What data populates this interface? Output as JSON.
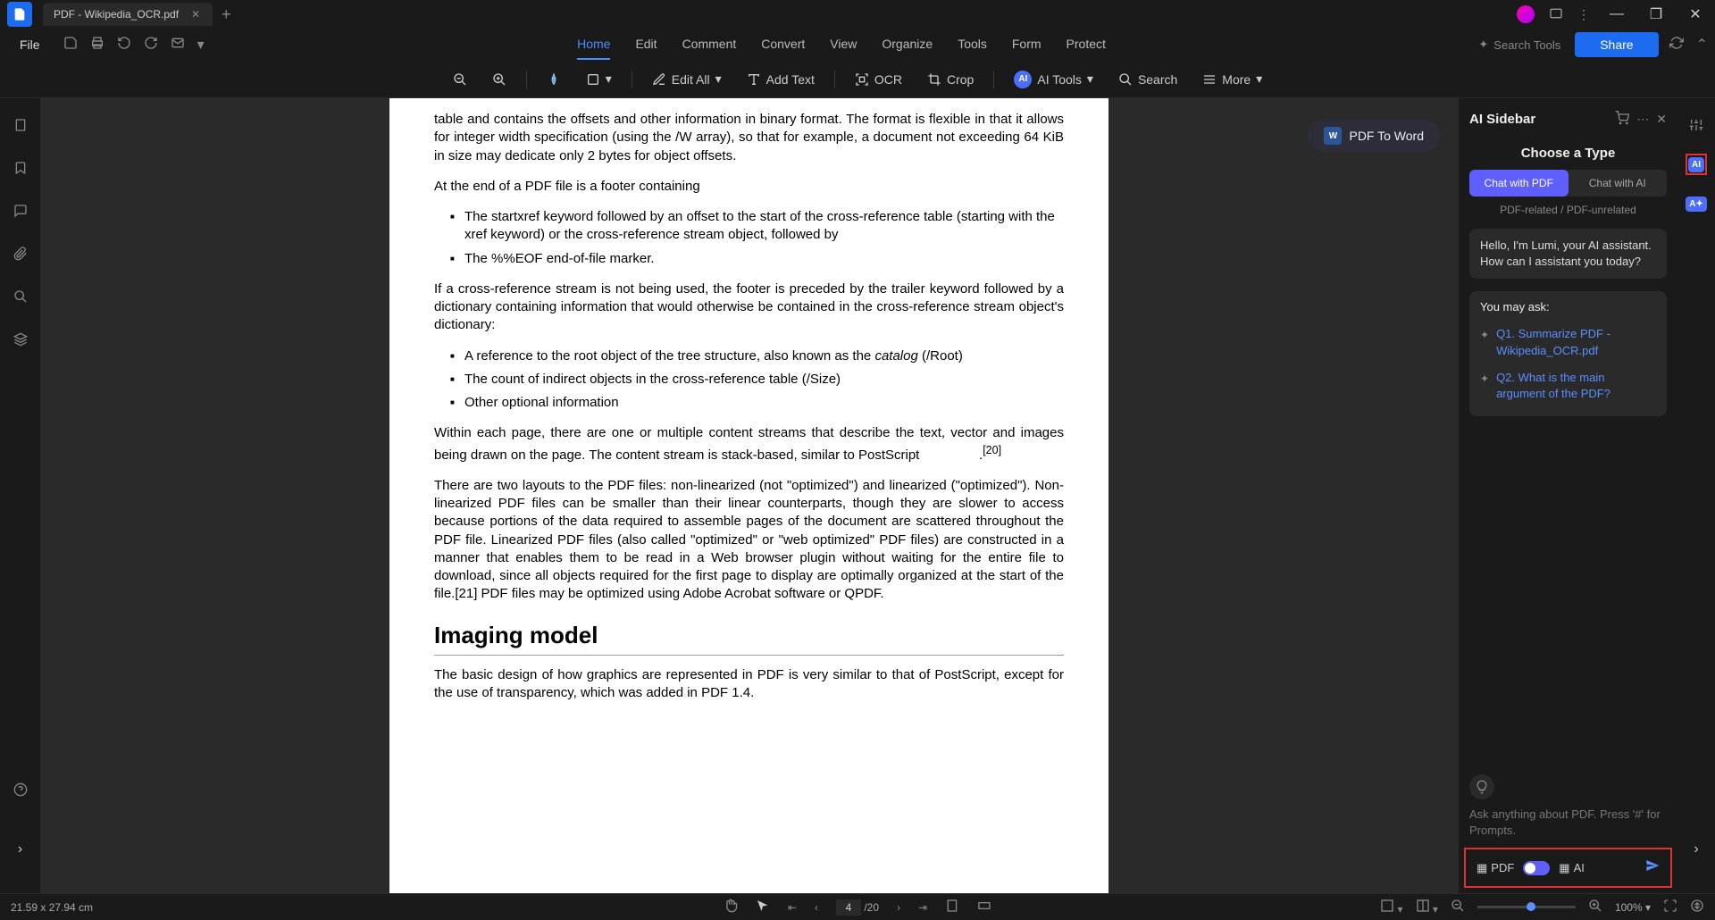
{
  "titlebar": {
    "tab_name": "PDF - Wikipedia_OCR.pdf"
  },
  "menubar": {
    "file": "File",
    "tabs": [
      "Home",
      "Edit",
      "Comment",
      "Convert",
      "View",
      "Organize",
      "Tools",
      "Form",
      "Protect"
    ],
    "active_tab": "Home",
    "search_tools": "Search Tools",
    "share": "Share"
  },
  "toolbar": {
    "edit_all": "Edit All",
    "add_text": "Add Text",
    "ocr": "OCR",
    "crop": "Crop",
    "ai_tools": "AI Tools",
    "search": "Search",
    "more": "More"
  },
  "pdf_to_word": "PDF To Word",
  "document": {
    "p1": "table and contains the offsets and other information in binary format. The format is flexible in that it allows for integer width specification (using the /W array), so that for example, a document not exceeding 64 KiB in size may dedicate only 2 bytes for object offsets.",
    "p2": "At the end of a PDF file is a footer containing",
    "li1": "The startxref keyword followed by an offset to the start of the cross-reference table (starting with the xref keyword) or the cross-reference stream object, followed by",
    "li2": "The %%EOF end-of-file marker.",
    "p3": "If a cross-reference stream is not being used, the footer is preceded by the trailer keyword followed by a dictionary containing information that would otherwise be contained in the cross-reference stream object's dictionary:",
    "li3a": "A reference to the root object of the tree structure, also known as the ",
    "li3b": "catalog",
    "li3c": " (/Root)",
    "li4": "The count of indirect objects in the cross-reference table (/Size)",
    "li5": "Other optional information",
    "p4": "Within each page, there are one or multiple content streams that describe the text, vector and images being drawn on the page. The content stream is stack-based, similar to PostScript",
    "p4ref": "[20]",
    "p5a": "There are two layouts to the PDF files: non-linearized (not \"optimized\") and linearized (\"optimized\"). Non-linearized PDF files can be smaller than their linear counterparts, though they are slower to access because portions of the data required to assemble pages of the document are scattered throughout the PDF file. Linearized PDF files (also called \"optimized\" or \"web optimized\" PDF files) are constructed in a manner that enables them to be read in a Web browser plugin without waiting for the entire file to download, since all objects required for the first page to display are optimally organized at the start of the file.[21] PDF files may be optimized using Adobe Acrobat software or QPDF.",
    "h2": "Imaging model",
    "p6": "The basic design of how graphics are represented in PDF is very similar to that of PostScript, except for the use of transparency, which was added in PDF 1.4."
  },
  "ai_sidebar": {
    "title": "AI Sidebar",
    "choose": "Choose a Type",
    "tab1": "Chat with PDF",
    "tab2": "Chat with AI",
    "subtext": "PDF-related / PDF-unrelated",
    "greeting": "Hello, I'm Lumi, your AI assistant. How can I assistant you today?",
    "you_may_ask": "You may ask:",
    "q1": "Q1. Summarize PDF - Wikipedia_OCR.pdf",
    "q2": "Q2. What is the main argument of the PDF?",
    "input_placeholder": "Ask anything about PDF. Press '#' for Prompts.",
    "pdf_label": "PDF",
    "ai_label": "AI"
  },
  "statusbar": {
    "dimensions": "21.59 x 27.94 cm",
    "current_page": "4",
    "total_pages": "/20",
    "zoom": "100%"
  }
}
